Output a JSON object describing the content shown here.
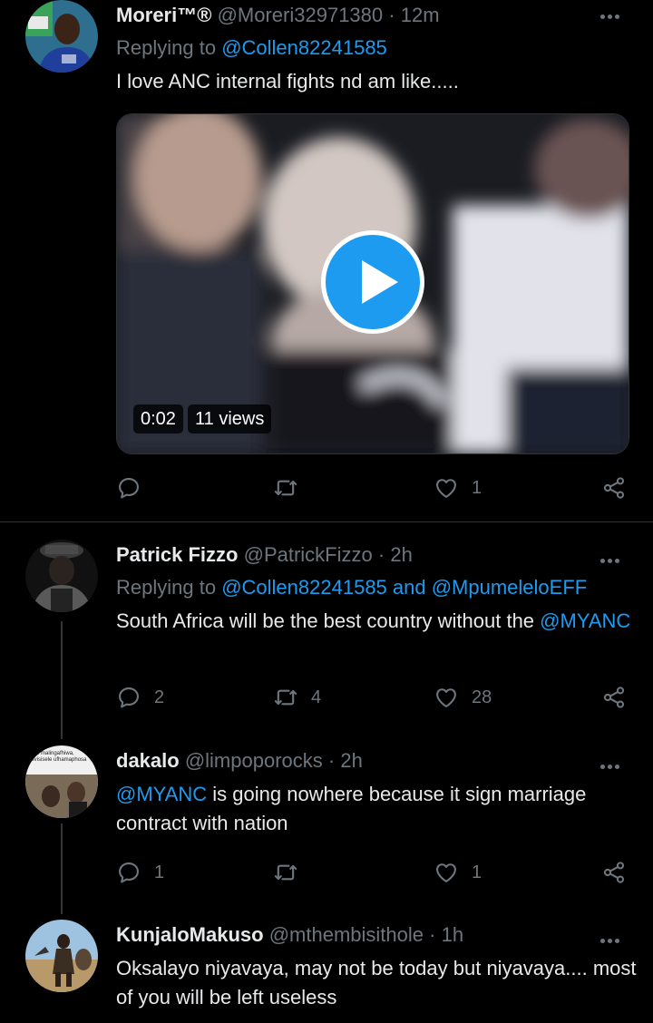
{
  "tweets": [
    {
      "name": "Moreri™®",
      "handle": "@Moreri32971380",
      "dot": "·",
      "time": "12m",
      "replying_prefix": "Replying to",
      "replying_to": "@Collen82241585",
      "text": "I love ANC internal fights nd am like.....",
      "media": {
        "type": "video",
        "duration": "0:02",
        "views": "11 views"
      },
      "actions": {
        "reply": "",
        "retweet": "",
        "like": "1"
      }
    },
    {
      "name": "Patrick Fizzo",
      "handle": "@PatrickFizzo",
      "dot": "·",
      "time": "2h",
      "replying_prefix": "Replying to",
      "replying_to": "@Collen82241585 and @MpumeleloEFF",
      "text_plain": "South Africa will be the best country without the",
      "text_link": "@MYANC",
      "actions": {
        "reply": "2",
        "retweet": "4",
        "like": "28"
      }
    },
    {
      "name": "dakalo",
      "handle": "@limpoporocks",
      "dot": "·",
      "time": "2h",
      "text_link": "@MYANC",
      "text_plain": " is going nowhere because it sign marriage contract with nation",
      "avatar_caption": "Ko malingafhiwa, Ivisisele ufhamaphosa",
      "actions": {
        "reply": "1",
        "retweet": "",
        "like": "1"
      }
    },
    {
      "name": "KunjaloMakuso",
      "handle": "@mthembisithole",
      "dot": "·",
      "time": "1h",
      "text": "Oksalayo niyavaya, may not be today but niyavaya.... most of you will be left useless"
    }
  ],
  "colors": {
    "background": "#000000",
    "accent": "#1d9bf0",
    "muted": "#6e767d",
    "text": "#e7e9ea"
  },
  "icons": {
    "reply": "reply-icon",
    "retweet": "retweet-icon",
    "like": "heart-icon",
    "share": "share-icon",
    "more": "more-icon",
    "play": "play-icon"
  }
}
